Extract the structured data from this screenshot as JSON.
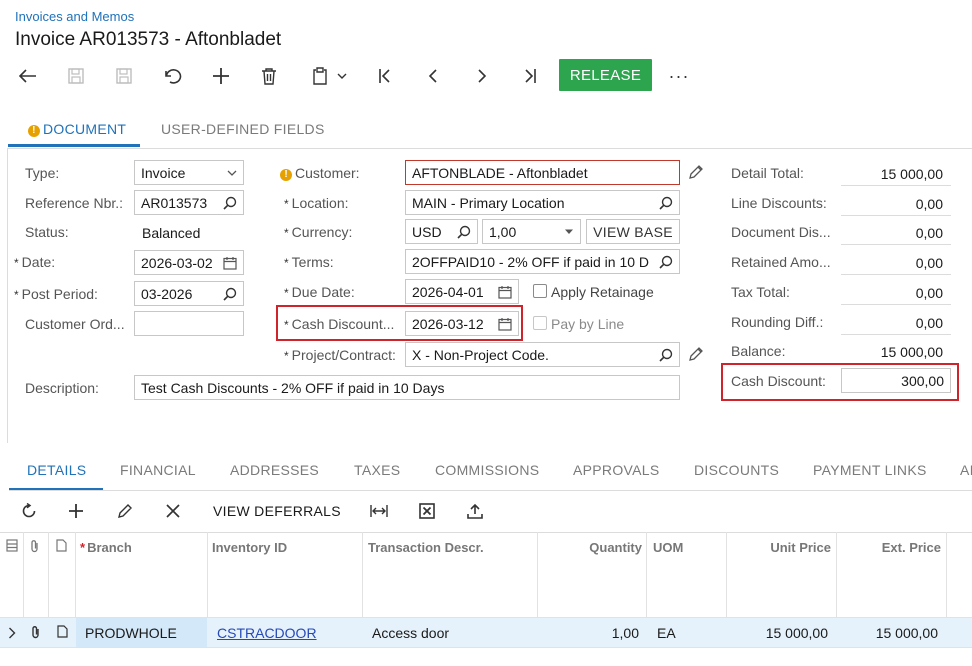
{
  "breadcrumb": "Invoices and Memos",
  "title": "Invoice AR013573 - Aftonbladet",
  "toolbar": {
    "back_icon": "arrow-left-icon",
    "release_label": "RELEASE",
    "more_label": "···"
  },
  "top_tabs": [
    {
      "label": "DOCUMENT",
      "active": true
    },
    {
      "label": "USER-DEFINED FIELDS",
      "active": false
    }
  ],
  "form": {
    "type": {
      "label": "Type:",
      "value": "Invoice"
    },
    "reference_nbr": {
      "label": "Reference Nbr.:",
      "value": "AR013573"
    },
    "status": {
      "label": "Status:",
      "value": "Balanced"
    },
    "date": {
      "label": "Date:",
      "value": "2026-03-02"
    },
    "post_period": {
      "label": "Post Period:",
      "value": "03-2026"
    },
    "customer_order": {
      "label": "Customer Ord...",
      "value": ""
    },
    "description": {
      "label": "Description:",
      "value": "Test Cash Discounts - 2% OFF if paid in 10 Days"
    },
    "customer": {
      "label": "Customer:",
      "value": "AFTONBLADE - Aftonbladet"
    },
    "location": {
      "label": "Location:",
      "value": "MAIN - Primary Location"
    },
    "currency": {
      "label": "Currency:",
      "value": "USD",
      "rate": "1,00",
      "view_base_label": "VIEW BASE"
    },
    "terms": {
      "label": "Terms:",
      "value": "2OFFPAID10 - 2% OFF if paid in 10 D"
    },
    "due_date": {
      "label": "Due Date:",
      "value": "2026-04-01"
    },
    "cash_discount_date": {
      "label": "Cash Discount...",
      "value": "2026-03-12"
    },
    "project": {
      "label": "Project/Contract:",
      "value": "X - Non-Project Code."
    },
    "apply_retainage": {
      "label": "Apply Retainage",
      "checked": false
    },
    "pay_by_line": {
      "label": "Pay by Line",
      "checked": false
    }
  },
  "totals": {
    "detail_total": {
      "label": "Detail Total:",
      "value": "15 000,00"
    },
    "line_discounts": {
      "label": "Line Discounts:",
      "value": "0,00"
    },
    "document_discount": {
      "label": "Document Dis...",
      "value": "0,00"
    },
    "retained_amount": {
      "label": "Retained Amo...",
      "value": "0,00"
    },
    "tax_total": {
      "label": "Tax Total:",
      "value": "0,00"
    },
    "rounding_diff": {
      "label": "Rounding Diff.:",
      "value": "0,00"
    },
    "balance": {
      "label": "Balance:",
      "value": "15 000,00"
    },
    "cash_discount": {
      "label": "Cash Discount:",
      "value": "300,00"
    }
  },
  "bottom_tabs": [
    {
      "label": "DETAILS",
      "active": true
    },
    {
      "label": "FINANCIAL",
      "active": false
    },
    {
      "label": "ADDRESSES",
      "active": false
    },
    {
      "label": "TAXES",
      "active": false
    },
    {
      "label": "COMMISSIONS",
      "active": false
    },
    {
      "label": "APPROVALS",
      "active": false
    },
    {
      "label": "DISCOUNTS",
      "active": false
    },
    {
      "label": "PAYMENT LINKS",
      "active": false
    },
    {
      "label": "AI",
      "active": false
    }
  ],
  "grid_toolbar": {
    "view_deferrals_label": "VIEW DEFERRALS"
  },
  "grid": {
    "headers": {
      "branch": "Branch",
      "inventory_id": "Inventory ID",
      "description": "Transaction Descr.",
      "quantity": "Quantity",
      "uom": "UOM",
      "unit_price": "Unit Price",
      "ext_price": "Ext. Price"
    },
    "rows": [
      {
        "branch": "PRODWHOLE",
        "inventory_id": "CSTRACDOOR",
        "description": "Access door",
        "quantity": "1,00",
        "uom": "EA",
        "unit_price": "15 000,00",
        "ext_price": "15 000,00"
      }
    ]
  },
  "colors": {
    "accent": "#2072b9",
    "release": "#2da44e",
    "highlight": "#d0242c",
    "selected_row": "#e5f2fb"
  }
}
